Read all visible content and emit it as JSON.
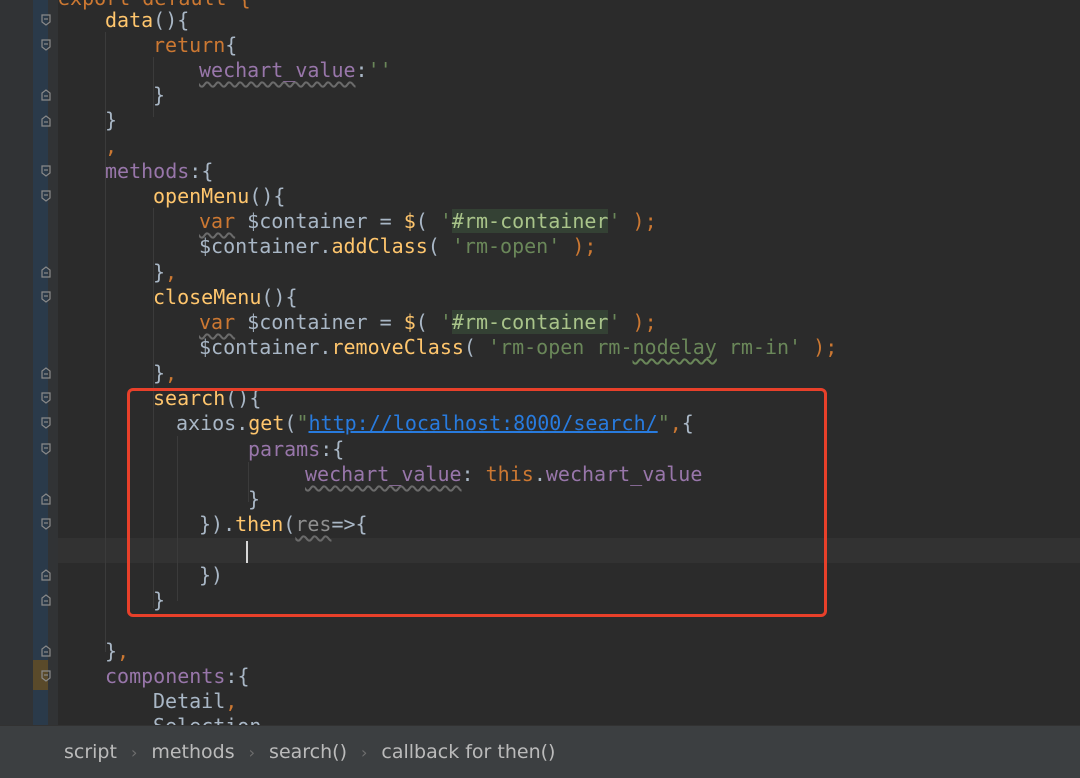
{
  "code": {
    "export_stub": "export default {",
    "data_fn": "data",
    "return_kw": "return",
    "wechart_value_key": "wechart_value",
    "empty_string": "''",
    "methods_key": "methods",
    "open_menu_fn": "openMenu",
    "var_kw": "var",
    "container_var": "$container",
    "dollar_fn": "$",
    "rm_container_str": "'#rm-container'",
    "add_class_fn": "addClass",
    "rm_open_str": "'rm-open'",
    "close_menu_fn": "closeMenu",
    "remove_class_fn": "removeClass",
    "remove_class_arg": "'rm-open rm-nodelay rm-in'",
    "search_fn": "search",
    "axios_obj": "axios",
    "get_fn": "get",
    "search_url": "http://localhost:8000/search/",
    "params_key": "params",
    "this_kw": "this",
    "then_fn": "then",
    "res_param": "res",
    "components_key": "components",
    "detail_component": "Detail",
    "selection_partial": "Selection"
  },
  "breadcrumb": {
    "items": [
      "script",
      "methods",
      "search()",
      "callback for then()"
    ]
  },
  "colors": {
    "background": "#2b2b2b",
    "keyword": "#cc7832",
    "function": "#ffc66d",
    "property": "#9876aa",
    "string": "#6a8759",
    "url": "#287bde",
    "highlight_box": "#e8402a"
  }
}
